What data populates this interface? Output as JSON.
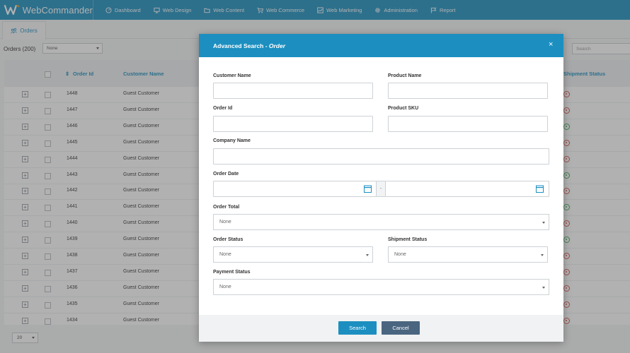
{
  "app": {
    "brand": "WebCommander"
  },
  "nav": [
    {
      "label": "Dashboard",
      "icon": "dashboard-icon"
    },
    {
      "label": "Web Design",
      "icon": "monitor-icon"
    },
    {
      "label": "Web Content",
      "icon": "folder-icon"
    },
    {
      "label": "Web Commerce",
      "icon": "cart-icon"
    },
    {
      "label": "Web Marketing",
      "icon": "chart-icon"
    },
    {
      "label": "Administration",
      "icon": "gear-icon"
    },
    {
      "label": "Report",
      "icon": "flag-icon"
    }
  ],
  "tab": {
    "label": "Orders"
  },
  "toolbar": {
    "orders_count": "Orders (200)",
    "filter_value": "None",
    "search_placeholder": "Search"
  },
  "grid": {
    "columns": {
      "order_id": "Order Id",
      "customer": "Customer Name",
      "shipment": "Shipment Status"
    },
    "rows": [
      {
        "id": "1448",
        "customer": "Guest Customer",
        "status": "red"
      },
      {
        "id": "1447",
        "customer": "Guest Customer",
        "status": "red"
      },
      {
        "id": "1446",
        "customer": "Guest Customer",
        "status": "green"
      },
      {
        "id": "1445",
        "customer": "Guest Customer",
        "status": "red"
      },
      {
        "id": "1444",
        "customer": "Guest Customer",
        "status": "red"
      },
      {
        "id": "1443",
        "customer": "Guest Customer",
        "status": "green"
      },
      {
        "id": "1442",
        "customer": "Guest Customer",
        "status": "red"
      },
      {
        "id": "1441",
        "customer": "Guest Customer",
        "status": "green"
      },
      {
        "id": "1440",
        "customer": "Guest Customer",
        "status": "red"
      },
      {
        "id": "1439",
        "customer": "Guest Customer",
        "status": "green"
      },
      {
        "id": "1438",
        "customer": "Guest Customer",
        "status": "red"
      },
      {
        "id": "1437",
        "customer": "Guest Customer",
        "status": "red"
      },
      {
        "id": "1436",
        "customer": "Guest Customer",
        "status": "red"
      },
      {
        "id": "1435",
        "customer": "Guest Customer",
        "status": "red"
      },
      {
        "id": "1434",
        "customer": "Guest Customer",
        "status": "red"
      }
    ],
    "page_size": "20"
  },
  "modal": {
    "title": "Advanced Search - ",
    "title_em": "Order",
    "close": "×",
    "fields": {
      "customer_name": "Customer Name",
      "product_name": "Product Name",
      "order_id": "Order Id",
      "product_sku": "Product SKU",
      "company_name": "Company Name",
      "order_date": "Order Date",
      "date_separator": "-",
      "order_total": "Order Total",
      "order_total_value": "None",
      "order_status": "Order Status",
      "order_status_value": "None",
      "shipment_status": "Shipment Status",
      "shipment_status_value": "None",
      "payment_status": "Payment Status",
      "payment_status_value": "None"
    },
    "buttons": {
      "search": "Search",
      "cancel": "Cancel"
    }
  },
  "colors": {
    "accent": "#1c8fc0",
    "cancel": "#4a6580",
    "status_red": "#d9534f",
    "status_green": "#3fae5b"
  }
}
